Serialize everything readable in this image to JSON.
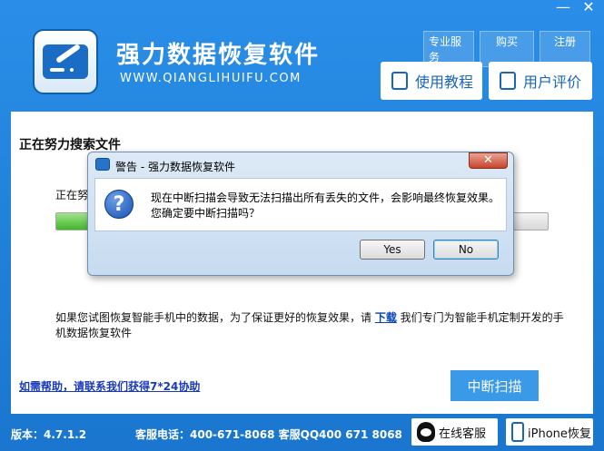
{
  "window": {
    "minimize": "—",
    "close": "✕"
  },
  "header": {
    "title": "强力数据恢复软件",
    "url": "WWW.QIANGLIHUIFU.COM",
    "links": [
      "专业服务",
      "购买",
      "注册"
    ],
    "tutorial_button": "使用教程",
    "review_button": "用户评价"
  },
  "main": {
    "section_title": "正在努力搜索文件",
    "status_text": "正在努",
    "progress": 0.07,
    "info_before": "如果您试图恢复智能手机中的数据，为了保证更好的恢复效果，请 ",
    "info_link": "下载",
    "info_after": " 我们专门为智能手机定制开发的手机数据恢复软件",
    "help_link": "如需帮助，请联系我们获得7*24协助",
    "stop_button": "中断扫描"
  },
  "footer": {
    "version": "版本：4.7.1.2",
    "contact": "客服电话：400-671-8068 客服QQ400 671 8068",
    "online_service": "在线客服",
    "iphone_recovery": "iPhone恢复"
  },
  "dialog": {
    "title": "警告 - 强力数据恢复软件",
    "close": "✕",
    "message_line1": "现在中断扫描会导致无法扫描出所有丢失的文件，会影响最终恢复效果。",
    "message_line2": "您确定要中断扫描吗？",
    "yes": "Yes",
    "no": "No"
  },
  "colors": {
    "brand": "#1f7fd6",
    "accent": "#3a9ae8",
    "progress": "#45b52c"
  }
}
